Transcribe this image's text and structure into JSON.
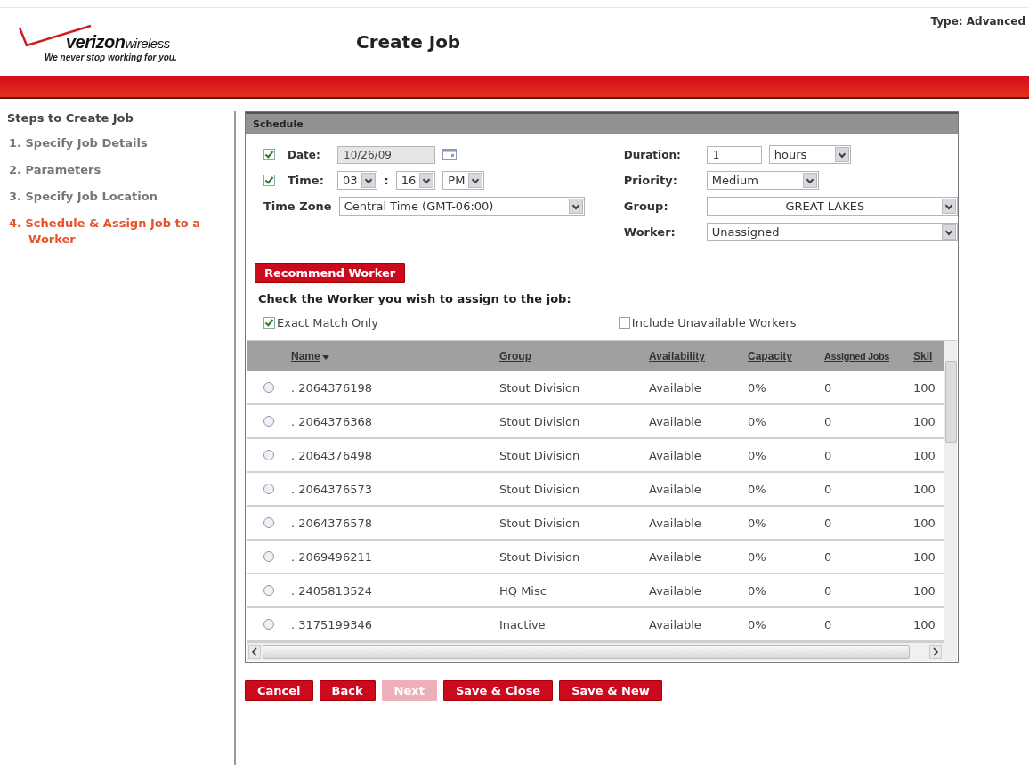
{
  "header": {
    "logo_word": "verizon",
    "logo_suffix": "wireless",
    "tagline": "We never stop working for you.",
    "title": "Create Job",
    "type_label": "Type: Advanced"
  },
  "steps": {
    "title": "Steps to Create Job",
    "items": [
      {
        "label": "1. Specify Job Details",
        "selected": false
      },
      {
        "label": "2. Parameters",
        "selected": false
      },
      {
        "label": "3. Specify Job Location",
        "selected": false
      },
      {
        "label": "4. Schedule & Assign Job to a Worker",
        "selected": true
      }
    ]
  },
  "schedule": {
    "title": "Schedule",
    "date": {
      "checked": true,
      "label": "Date:",
      "value": "10/26/09"
    },
    "time": {
      "checked": true,
      "label": "Time:",
      "hour": "03",
      "separator": ":",
      "minute": "16",
      "ampm": "PM"
    },
    "time_zone": {
      "label": "Time Zone",
      "value": "Central Time (GMT-06:00)"
    },
    "duration": {
      "label": "Duration:",
      "value": "1",
      "unit": "hours"
    },
    "priority": {
      "label": "Priority:",
      "value": "Medium"
    },
    "group": {
      "label": "Group:",
      "value": "GREAT LAKES"
    },
    "worker": {
      "label": "Worker:",
      "value": "Unassigned"
    },
    "recommend_button": "Recommend Worker",
    "instruction": "Check the Worker you wish to assign to the job:",
    "exact_match": {
      "label": "Exact Match Only",
      "checked": true
    },
    "include_unavailable": {
      "label": "Include Unavailable Workers",
      "checked": false
    }
  },
  "table": {
    "columns": [
      "Name",
      "Group",
      "Availability",
      "Capacity",
      "Assigned Jobs",
      "Skil"
    ],
    "rows": [
      {
        "selected": false,
        "cells": [
          ". 2064376198",
          "Stout Division",
          "Available",
          "0%",
          "0",
          "100"
        ]
      },
      {
        "selected": false,
        "cells": [
          ". 2064376368",
          "Stout Division",
          "Available",
          "0%",
          "0",
          "100"
        ]
      },
      {
        "selected": false,
        "cells": [
          ". 2064376498",
          "Stout Division",
          "Available",
          "0%",
          "0",
          "100"
        ]
      },
      {
        "selected": false,
        "cells": [
          ". 2064376573",
          "Stout Division",
          "Available",
          "0%",
          "0",
          "100"
        ]
      },
      {
        "selected": false,
        "cells": [
          ". 2064376578",
          "Stout Division",
          "Available",
          "0%",
          "0",
          "100"
        ]
      },
      {
        "selected": false,
        "cells": [
          ". 2069496211",
          "Stout Division",
          "Available",
          "0%",
          "0",
          "100"
        ]
      },
      {
        "selected": false,
        "cells": [
          ". 2405813524",
          "HQ Misc",
          "Available",
          "0%",
          "0",
          "100"
        ]
      },
      {
        "selected": false,
        "cells": [
          ". 3175199346",
          "Inactive",
          "Available",
          "0%",
          "0",
          "100"
        ]
      }
    ]
  },
  "buttons": [
    {
      "label": "Cancel",
      "disabled": false
    },
    {
      "label": "Back",
      "disabled": false
    },
    {
      "label": "Next",
      "disabled": true
    },
    {
      "label": "Save & Close",
      "disabled": false
    },
    {
      "label": "Save & New",
      "disabled": false
    }
  ]
}
